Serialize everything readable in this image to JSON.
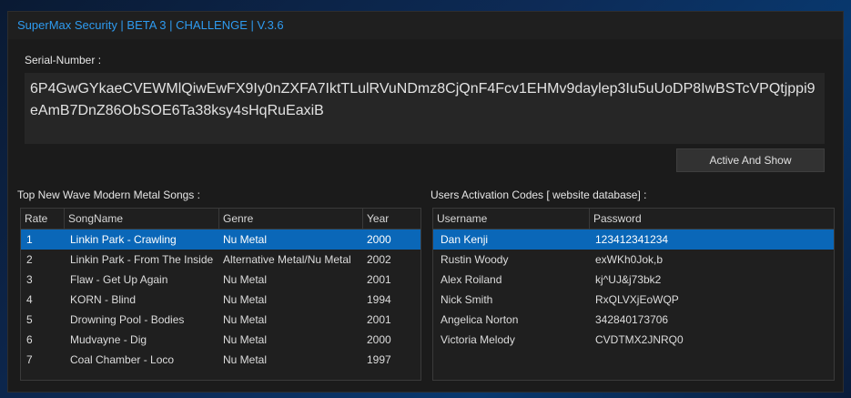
{
  "window": {
    "title": "SuperMax Security | BETA 3 | CHALLENGE | V.3.6"
  },
  "serial": {
    "label": "Serial-Number :",
    "value": "6P4GwGYkaeCVEWMlQiwEwFX9Iy0nZXFA7IktTLulRVuNDmz8CjQnF4Fcv1EHMv9daylep3Iu5uUoDP8IwBSTcVPQtjppi9eAmB7DnZ86ObSOE6Ta38ksy4sHqRuEaxiB"
  },
  "actions": {
    "active_and_show": "Active And Show"
  },
  "songs": {
    "label": "Top New Wave Modern Metal Songs :",
    "columns": [
      "Rate",
      "SongName",
      "Genre",
      "Year"
    ],
    "rows": [
      [
        "1",
        "Linkin Park - Crawling",
        "Nu Metal",
        "2000"
      ],
      [
        "2",
        "Linkin Park - From The Inside",
        "Alternative Metal/Nu Metal",
        "2002"
      ],
      [
        "3",
        "Flaw - Get Up Again",
        "Nu Metal",
        "2001"
      ],
      [
        "4",
        "KORN - Blind",
        "Nu Metal",
        "1994"
      ],
      [
        "5",
        "Drowning Pool - Bodies",
        "Nu Metal",
        "2001"
      ],
      [
        "6",
        "Mudvayne - Dig",
        "Nu Metal",
        "2000"
      ],
      [
        "7",
        "Coal Chamber - Loco",
        "Nu Metal",
        "1997"
      ]
    ],
    "selected_row": 0
  },
  "users": {
    "label": "Users Activation Codes [ website database]  :",
    "columns": [
      "Username",
      "Password"
    ],
    "rows": [
      [
        "Dan Kenji",
        "123412341234"
      ],
      [
        "Rustin Woody",
        "exWKh0Jok,b"
      ],
      [
        "Alex Roiland",
        "kj^UJ&j73bk2"
      ],
      [
        "Nick Smith",
        "RxQLVXjEoWQP"
      ],
      [
        "Angelica Norton",
        "342840173706"
      ],
      [
        "Victoria Melody",
        "CVDTMX2JNRQ0"
      ]
    ],
    "selected_row": 0
  },
  "colors": {
    "accent": "#2e9bf0",
    "selection": "#0a67b8",
    "window_bg": "#1b1b1b"
  }
}
